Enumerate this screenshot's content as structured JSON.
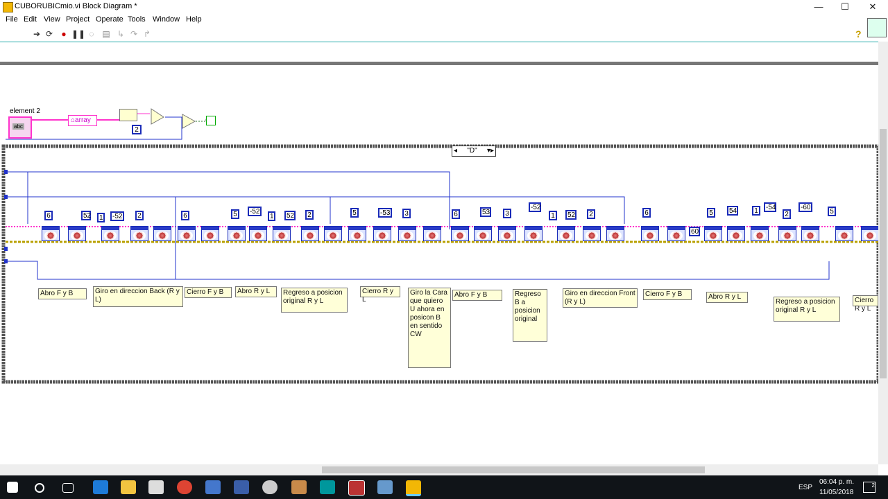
{
  "window": {
    "title": "CUBORUBICmio.vi Block Diagram *",
    "controls": {
      "minimize": "—",
      "maximize": "☐",
      "close": "✕"
    }
  },
  "menu": [
    "File",
    "Edit",
    "View",
    "Project",
    "Operate",
    "Tools",
    "Window",
    "Help"
  ],
  "toolbar_icons": [
    "run-arrow-icon",
    "run-continuous-icon",
    "abort-icon",
    "pause-icon",
    "highlight-bulb-icon",
    "retain-wire-icon",
    "step-into-icon",
    "step-over-icon",
    "step-out-icon"
  ],
  "help_icon": "?",
  "diagram": {
    "element_label": "element 2",
    "element_indicator": "abc",
    "array_label": "array",
    "const_two": "2",
    "case_selector": "\"D\"",
    "constants": [
      "6",
      "52",
      "1",
      "-52",
      "2",
      "6",
      "5",
      "-52",
      "1",
      "52",
      "2",
      "5",
      "-53",
      "3",
      "6",
      "53",
      "3",
      "-52",
      "1",
      "52",
      "2",
      "6",
      "5",
      "54",
      "1",
      "-54",
      "2",
      "-60",
      "5",
      "60"
    ],
    "comments": [
      "Abro F y B",
      "Giro en direccion Back (R y L)",
      "Cierro F y B",
      "Abro R y L",
      "Regreso a posicion original R y L",
      "Cierro R y L",
      "Giro la Cara que quiero U ahora en posicon B en sentido CW",
      "Abro F y B",
      "Regreso B a posicion original",
      "Giro en direccion Front (R y L)",
      "Cierro F y B",
      "Abro R y L",
      "Regreso a posicion original R y L",
      "Cierro R y L"
    ]
  },
  "taskbar": {
    "lang": "ESP",
    "time": "06:04 p. m.",
    "date": "11/05/2018",
    "notification_count": "2"
  }
}
